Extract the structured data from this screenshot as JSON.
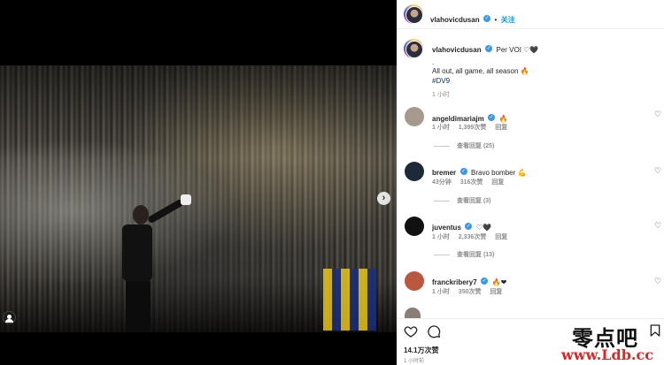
{
  "post": {
    "username": "vlahovicdusan",
    "follow_label": "关注",
    "separator": "•",
    "caption_line1_suffix": "Per VOI ♡🖤",
    "caption_line2": ".",
    "caption_line3": "All out, all game, all season 🔥",
    "caption_line4": "#DV9",
    "caption_time": "1 小时"
  },
  "comments": [
    {
      "username": "angeldimariajm",
      "text": "🔥",
      "time": "1 小时",
      "likes": "1,399次赞",
      "reply": "回复",
      "view_replies": "查看回复 (25)"
    },
    {
      "username": "bremer",
      "text": "Bravo bomber 💪",
      "time": "43分钟",
      "likes": "316次赞",
      "reply": "回复",
      "view_replies": "查看回复 (3)"
    },
    {
      "username": "juventus",
      "text": "♡🖤",
      "time": "1 小时",
      "likes": "2,336次赞",
      "reply": "回复",
      "view_replies": "查看回复 (13)"
    },
    {
      "username": "franckribery7",
      "text": "🔥❤",
      "time": "1 小时",
      "likes": "350次赞",
      "reply": "回复",
      "view_replies": ""
    }
  ],
  "footer": {
    "likes": "14.1万次赞",
    "time": "1 小时前"
  },
  "watermark": {
    "cn": "零点吧",
    "url": "www.Ldb.cc"
  },
  "icons": {
    "verified": "✓",
    "heart": "♡",
    "carousel_next": "›"
  },
  "colors": {
    "verified": "#3897f0",
    "follow": "#0095f6",
    "meta": "#8e8e8e",
    "watermark_url": "#e02424"
  }
}
